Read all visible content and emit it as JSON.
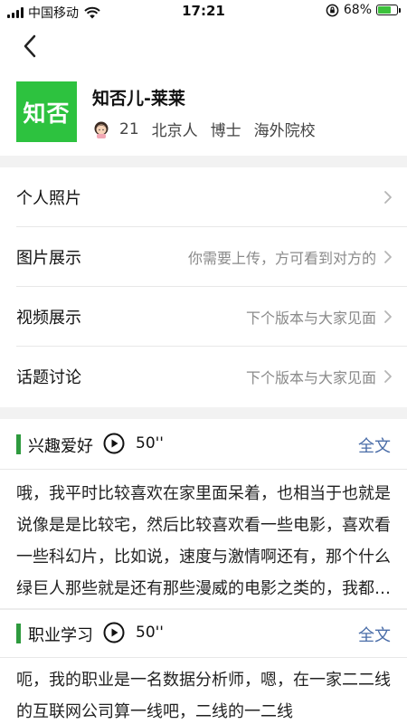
{
  "status_bar": {
    "carrier": "中国移动",
    "time": "17:21",
    "battery_percent": "68%",
    "battery_level": 0.68
  },
  "profile": {
    "logo_text": "知否",
    "name": "知否儿-莱莱",
    "age": "21",
    "hometown": "北京人",
    "degree": "博士",
    "school": "海外院校"
  },
  "menu": {
    "items": [
      {
        "label": "个人照片",
        "hint": ""
      },
      {
        "label": "图片展示",
        "hint": "你需要上传，方可看到对方的"
      },
      {
        "label": "视频展示",
        "hint": "下个版本与大家见面"
      },
      {
        "label": "话题讨论",
        "hint": "下个版本与大家见面"
      }
    ]
  },
  "sections": [
    {
      "title": "兴趣爱好",
      "duration": "50''",
      "full_label": "全文",
      "text": "哦，我平时比较喜欢在家里面呆着，也相当于也就是说像是是比较宅，然后比较喜欢看一些电影，喜欢看一些科幻片，比如说，速度与激情啊还有，那个什么绿巨人那些就是还有那些漫威的电影之类的，我都很喜欢看。"
    },
    {
      "title": "职业学习",
      "duration": "50''",
      "full_label": "全文",
      "text": "呃，我的职业是一名数据分析师，嗯，在一家二二线的互联网公司算一线吧，二线的一二线"
    }
  ],
  "icons": {
    "back": "chevron-left-icon",
    "chevron": "chevron-right-icon",
    "play": "play-circle-icon",
    "avatar": "girl-avatar-icon"
  },
  "colors": {
    "brand_green": "#2dc23f",
    "section_bar": "#2e9a3e",
    "link_blue": "#4a6da8",
    "hint_gray": "#8a8a8a",
    "band_gray": "#f2f2f2"
  }
}
